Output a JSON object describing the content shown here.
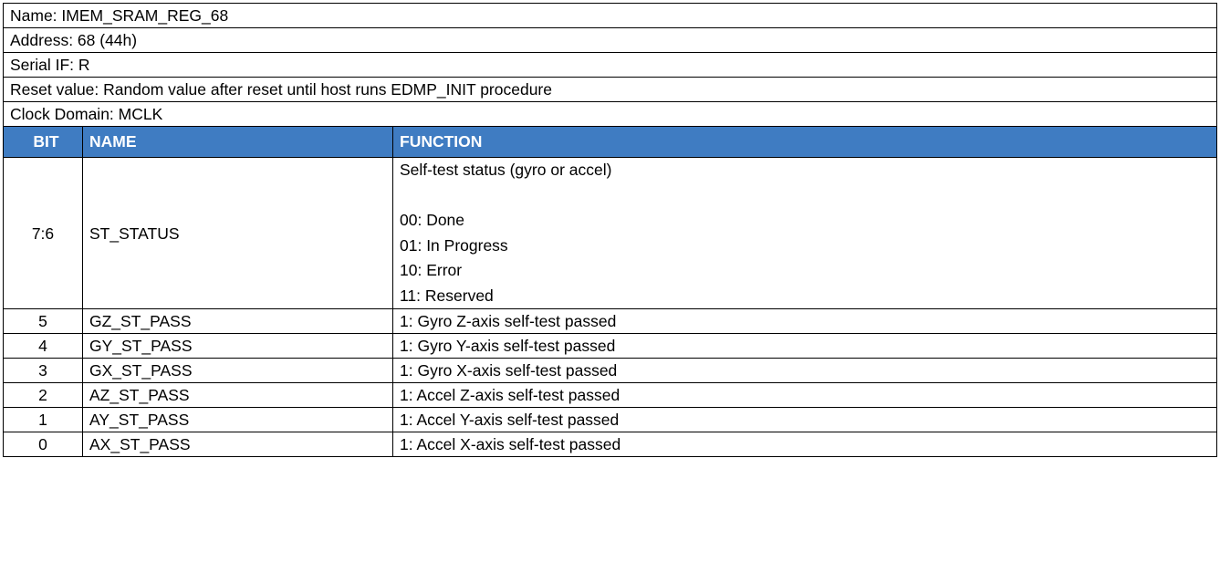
{
  "info": {
    "name": "Name: IMEM_SRAM_REG_68",
    "address": "Address: 68 (44h)",
    "serial_if": "Serial IF: R",
    "reset_value": "Reset value: Random value after reset until host runs EDMP_INIT procedure",
    "clock_domain": "Clock Domain: MCLK"
  },
  "colors": {
    "header_bg": "#3f7cc2",
    "header_text": "#ffffff",
    "border": "#000000"
  },
  "columns": {
    "bit": "BIT",
    "name": "NAME",
    "function": "FUNCTION"
  },
  "rows": [
    {
      "bit": "7:6",
      "name": "ST_STATUS",
      "function_lines": [
        "Self-test status (gyro or accel)",
        "",
        "00: Done",
        "01: In Progress",
        "10: Error",
        "11: Reserved"
      ]
    },
    {
      "bit": "5",
      "name": "GZ_ST_PASS",
      "function": "1: Gyro Z-axis self-test passed"
    },
    {
      "bit": "4",
      "name": "GY_ST_PASS",
      "function": "1: Gyro Y-axis self-test passed"
    },
    {
      "bit": "3",
      "name": "GX_ST_PASS",
      "function": "1: Gyro X-axis self-test passed"
    },
    {
      "bit": "2",
      "name": "AZ_ST_PASS",
      "function": "1: Accel Z-axis self-test passed"
    },
    {
      "bit": "1",
      "name": "AY_ST_PASS",
      "function": "1: Accel Y-axis self-test passed"
    },
    {
      "bit": "0",
      "name": "AX_ST_PASS",
      "function": "1: Accel X-axis self-test passed"
    }
  ]
}
